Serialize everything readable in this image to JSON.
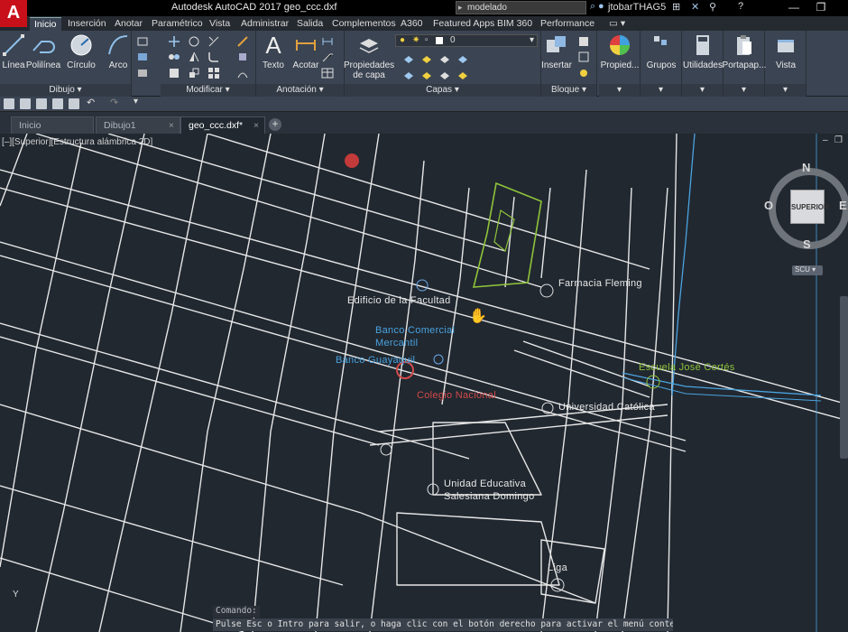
{
  "app": {
    "title": "Autodesk AutoCAD 2017   geo_ccc.dxf",
    "search_value": "modelado",
    "user": "jtobarTHAG5"
  },
  "ribbon_tabs": [
    {
      "label": "Inicio",
      "active": true
    },
    {
      "label": "Inserción"
    },
    {
      "label": "Anotar"
    },
    {
      "label": "Paramétrico"
    },
    {
      "label": "Vista"
    },
    {
      "label": "Administrar"
    },
    {
      "label": "Salida"
    },
    {
      "label": "Complementos"
    },
    {
      "label": "A360"
    },
    {
      "label": "Featured Apps"
    },
    {
      "label": "BIM 360"
    },
    {
      "label": "Performance"
    }
  ],
  "ribbon": {
    "draw": {
      "title": "Dibujo ▾",
      "line": "Línea",
      "polyline": "Polilínea",
      "circle": "Círculo",
      "arc": "Arco"
    },
    "modify": {
      "title": "Modificar ▾"
    },
    "annotation": {
      "title": "Anotación ▾",
      "text": "Texto",
      "dimension": "Acotar"
    },
    "layers": {
      "title": "Capas ▾",
      "props": "Propiedades de capa",
      "current_layer": "0"
    },
    "block": {
      "title": "Bloque ▾",
      "insert": "Insertar"
    },
    "properties": {
      "label": "Propied..."
    },
    "groups": {
      "label": "Grupos"
    },
    "utilities": {
      "label": "Utilidades"
    },
    "clipboard": {
      "label": "Portapap..."
    },
    "view": {
      "label": "Vista"
    }
  },
  "doc_tabs": [
    {
      "label": "Inicio"
    },
    {
      "label": "Dibujo1"
    },
    {
      "label": "geo_ccc.dxf*",
      "active": true
    }
  ],
  "viewport": {
    "label": "[–][Superior][Estructura alámbrica 2D]"
  },
  "viewcube": {
    "face": "SUPERIOR",
    "north": "N",
    "south": "S",
    "east": "E",
    "west": "O",
    "ucs": "SCU"
  },
  "map_labels": [
    {
      "text": "Edificio de la Facultad",
      "color": "white"
    },
    {
      "text": "Farmacia Fleming",
      "color": "white"
    },
    {
      "text": "Banco Comercial",
      "color": "blue"
    },
    {
      "text": "Mercantil",
      "color": "blue"
    },
    {
      "text": "Banco Guayaquil",
      "color": "blue"
    },
    {
      "text": "Colegio Nacional",
      "color": "red"
    },
    {
      "text": "Universidad Católica",
      "color": "white"
    },
    {
      "text": "Escuela José Cortés",
      "color": "green"
    },
    {
      "text": "Unidad Educativa",
      "color": "white"
    },
    {
      "text": "Salesiana Domingo",
      "color": "white"
    },
    {
      "text": "Liga",
      "color": "white"
    }
  ],
  "command": {
    "label": "Comando:",
    "text": "Pulse Esc o Intro para salir, o haga clic con el botón derecho para activar el menú contextual."
  },
  "colors": {
    "background": "#212830",
    "ribbon": "#3b4452",
    "accent": "#c8101a",
    "road": "#e8e8e8",
    "river": "#4aa3e0",
    "park": "#8fc33a"
  }
}
